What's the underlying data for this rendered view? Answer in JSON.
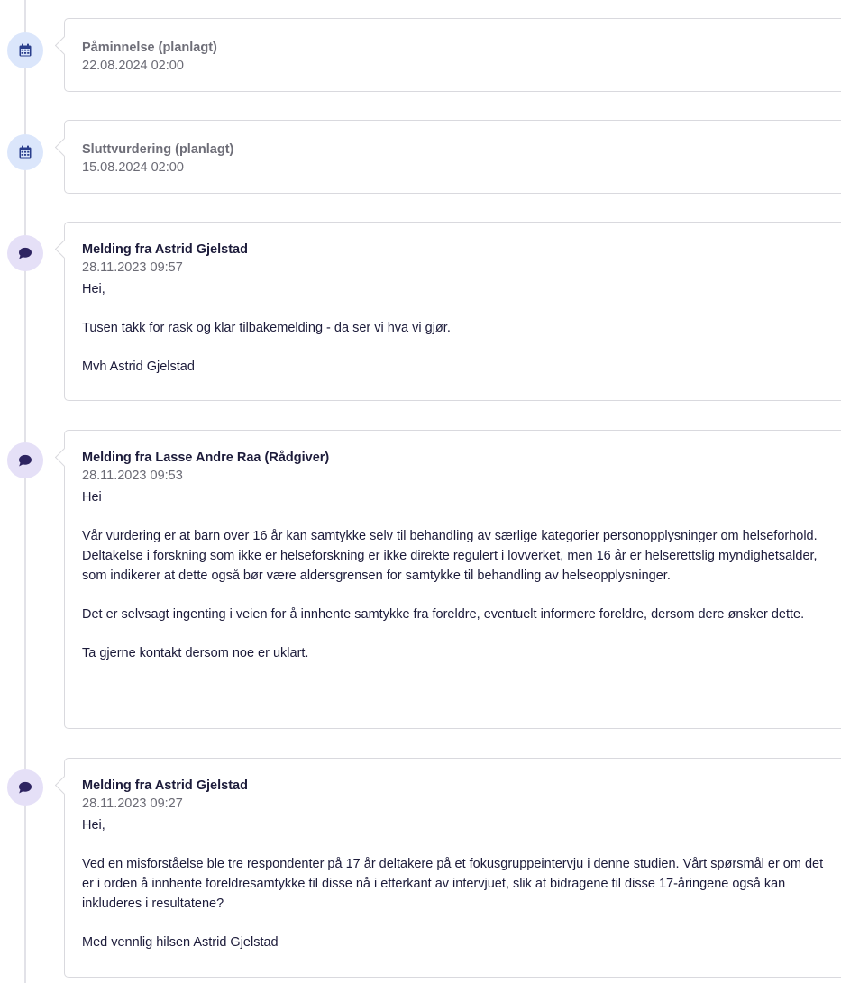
{
  "colors": {
    "calendar_icon_bg": "#dbe6fb",
    "calendar_icon_fg": "#2a3e8c",
    "message_icon_bg": "#e5e0f7",
    "message_icon_fg": "#2e2461",
    "card_border": "#d9d9de",
    "timeline_line": "#e2e2e8"
  },
  "timeline": [
    {
      "icon": "calendar-icon",
      "title": "Påminnelse (planlagt)",
      "date": "22.08.2024 02:00"
    },
    {
      "icon": "calendar-icon",
      "title": "Sluttvurdering (planlagt)",
      "date": "15.08.2024 02:00"
    },
    {
      "icon": "message-icon",
      "title": "Melding fra Astrid Gjelstad",
      "date": "28.11.2023 09:57",
      "paragraphs": [
        "Hei,",
        "Tusen takk for rask og klar tilbakemelding - da ser vi hva vi gjør.",
        "Mvh Astrid Gjelstad"
      ]
    },
    {
      "icon": "message-icon",
      "title": "Melding fra Lasse Andre Raa (Rådgiver)",
      "date": "28.11.2023 09:53",
      "paragraphs": [
        "Hei",
        "Vår vurdering er at barn over 16 år kan samtykke selv til behandling av særlige kategorier personopplysninger om helseforhold. Deltakelse i forskning som ikke er helseforskning er ikke direkte regulert i lovverket, men 16 år er helserettslig myndighetsalder, som indikerer at dette også bør være aldersgrensen for samtykke til behandling av helseopplysninger.",
        "Det er selvsagt ingenting i veien for å innhente samtykke fra foreldre, eventuelt informere foreldre, dersom dere ønsker dette.",
        "Ta gjerne kontakt dersom noe er uklart."
      ]
    },
    {
      "icon": "message-icon",
      "title": "Melding fra Astrid Gjelstad",
      "date": "28.11.2023 09:27",
      "paragraphs": [
        "Hei,",
        "Ved en misforståelse ble tre respondenter på 17 år deltakere på et fokusgruppeintervju i denne studien. Vårt spørsmål er om det er i orden å innhente foreldresamtykke til disse nå i etterkant av intervjuet, slik at bidragene til disse 17-åringene også kan inkluderes i resultatene?",
        "Med vennlig hilsen Astrid Gjelstad"
      ]
    }
  ]
}
